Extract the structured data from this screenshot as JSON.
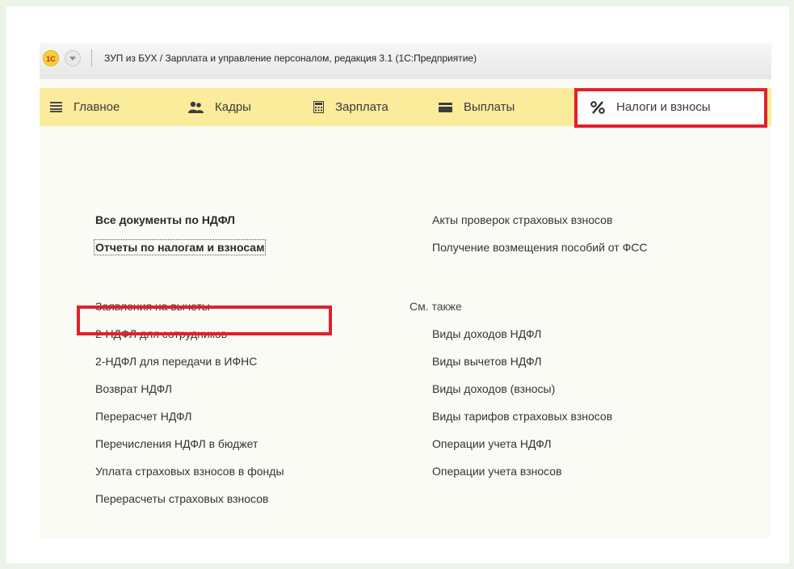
{
  "window": {
    "logo": "1С",
    "title": "ЗУП из БУХ / Зарплата и управление персоналом, редакция 3.1  (1С:Предприятие)"
  },
  "sections": [
    {
      "label": "Главное",
      "icon": "menu-lines-icon"
    },
    {
      "label": "Кадры",
      "icon": "people-icon"
    },
    {
      "label": "Зарплата",
      "icon": "calculator-icon"
    },
    {
      "label": "Выплаты",
      "icon": "wallet-icon"
    },
    {
      "label": "Налоги и взносы",
      "icon": "percent-icon",
      "active": true
    }
  ],
  "left_links": {
    "bold": [
      "Все документы по НДФЛ",
      "Отчеты по налогам и взносам"
    ],
    "items": [
      "Заявления на вычеты",
      "2-НДФЛ для сотрудников",
      "2-НДФЛ для передачи в ИФНС",
      "Возврат НДФЛ",
      "Перерасчет НДФЛ",
      "Перечисления НДФЛ в бюджет",
      "Уплата страховых взносов в фонды",
      "Перерасчеты страховых взносов"
    ]
  },
  "right_links": {
    "items": [
      "Акты проверок страховых взносов",
      "Получение возмещения пособий от ФСС"
    ],
    "see_also_label": "См. также",
    "see_also": [
      "Виды доходов НДФЛ",
      "Виды вычетов НДФЛ",
      "Виды доходов (взносы)",
      "Виды тарифов страховых взносов",
      "Операции учета НДФЛ",
      "Операции учета взносов"
    ]
  },
  "colors": {
    "section_panel": "#fbec9c",
    "highlight": "#e0202c",
    "content_bg": "#fbfbf5"
  }
}
